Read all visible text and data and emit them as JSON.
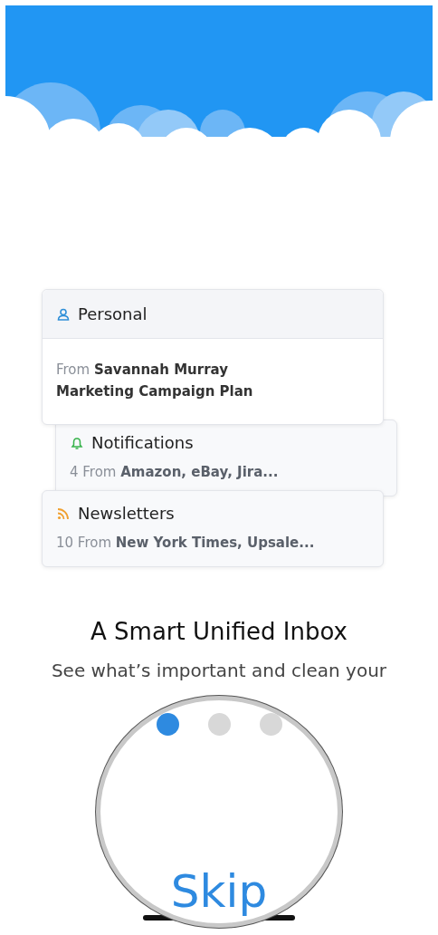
{
  "categories": [
    {
      "kind": "personal",
      "title": "Personal",
      "line": "From **Savannah Murray**",
      "subject": "Marketing Campaign Plan"
    },
    {
      "kind": "notifications",
      "title": "Notifications",
      "line": "4 From **Amazon, eBay, Jira...**"
    },
    {
      "kind": "newsletters",
      "title": "Newsletters",
      "line": "10 From **New York Times, Upsale...**"
    }
  ],
  "headline": "A Smart Unified Inbox",
  "description": "See what’s important and clean your",
  "pager": [
    {
      "selected": true
    },
    {
      "selected": false
    },
    {
      "selected": false
    }
  ],
  "skip_button": "Skip"
}
